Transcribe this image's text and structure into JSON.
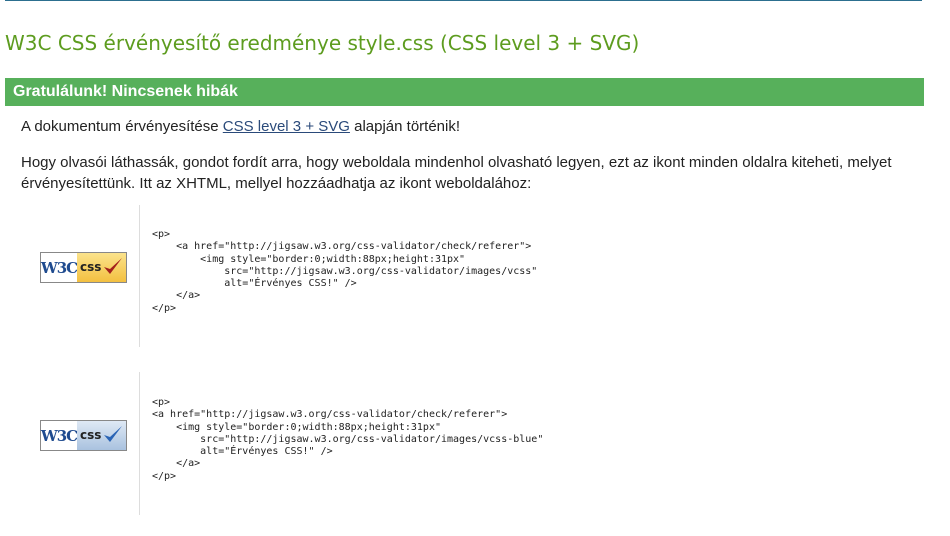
{
  "page": {
    "title": "W3C CSS érvényesítő eredménye style.css (CSS level 3 + SVG)",
    "banner": "Gratulálunk! Nincsenek hibák",
    "validation": {
      "prefix": "A dokumentum érvényesítése ",
      "link_text": "CSS level 3 + SVG",
      "suffix": " alapján történik!"
    },
    "icon_intro": "Hogy olvasói láthassák, gondot fordít arra, hogy weboldala mindenhol olvasható legyen, ezt az ikont minden oldalra kiteheti, melyet érvényesítettünk. Itt az XHTML, mellyel hozzáadhatja az ikont weboldalához:"
  },
  "colors": {
    "title": "#5d9c1f",
    "banner_bg": "#57b05b",
    "link": "#2a4a7a",
    "check_red": "#a3201c",
    "check_blue": "#2a64b5"
  },
  "badges": [
    {
      "logo_text": "W3C",
      "label": "css",
      "style": "yellow",
      "icon": "checkmark-red-icon",
      "code": "<p>\n    <a href=\"http://jigsaw.w3.org/css-validator/check/referer\">\n        <img style=\"border:0;width:88px;height:31px\"\n            src=\"http://jigsaw.w3.org/css-validator/images/vcss\"\n            alt=\"Érvényes CSS!\" />\n    </a>\n</p>"
    },
    {
      "logo_text": "W3C",
      "label": "css",
      "style": "blue",
      "icon": "checkmark-blue-icon",
      "code": "<p>\n<a href=\"http://jigsaw.w3.org/css-validator/check/referer\">\n    <img style=\"border:0;width:88px;height:31px\"\n        src=\"http://jigsaw.w3.org/css-validator/images/vcss-blue\"\n        alt=\"Érvényes CSS!\" />\n    </a>\n</p>"
    }
  ]
}
